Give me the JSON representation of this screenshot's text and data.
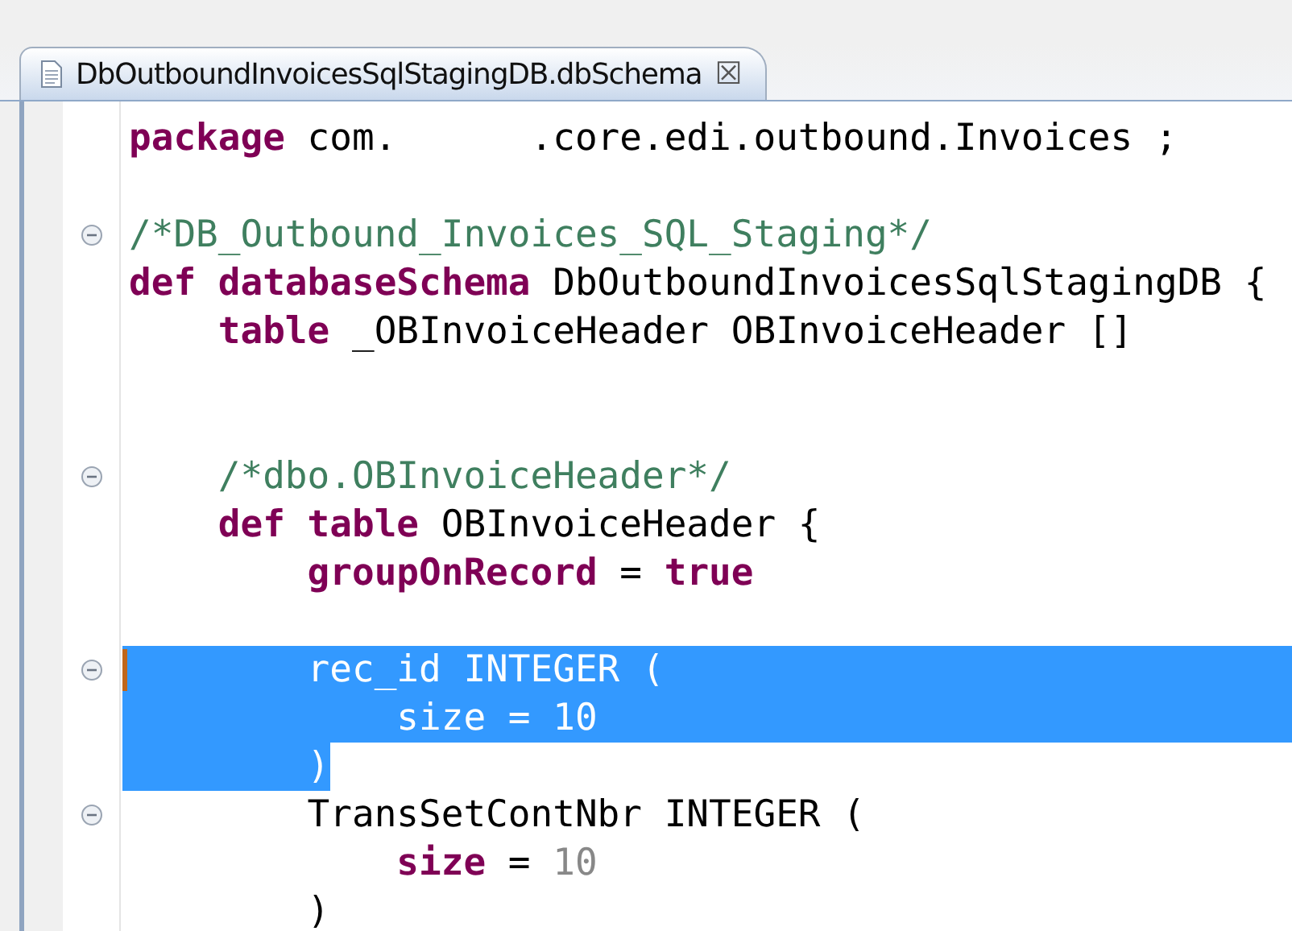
{
  "tab": {
    "title": "DbOutboundInvoicesSqlStagingDB.dbSchema",
    "close": "☒",
    "selected": true
  },
  "lines": [
    {
      "selected": false,
      "changed": false,
      "tokens": [
        {
          "kind": "keyword",
          "text": "package"
        },
        {
          "kind": "plain",
          "text": " com.      .core.edi.outbound.Invoices ;"
        }
      ]
    },
    {
      "selected": false,
      "changed": false
    },
    {
      "folded": false,
      "selected": false,
      "changed": false,
      "tokens": [
        {
          "kind": "comment",
          "text": "/*DB_Outbound_Invoices_SQL_Staging*/"
        }
      ]
    },
    {
      "selected": false,
      "changed": false,
      "tokens": [
        {
          "kind": "keyword",
          "text": "def databaseSchema"
        },
        {
          "kind": "plain",
          "text": " DbOutboundInvoicesSqlStagingDB {"
        }
      ]
    },
    {
      "selected": false,
      "changed": false,
      "tokens": [
        {
          "kind": "keyword",
          "text": "    table"
        },
        {
          "kind": "plain",
          "text": " _OBInvoiceHeader OBInvoiceHeader []"
        }
      ]
    },
    {
      "selected": false,
      "changed": false
    },
    {
      "selected": false,
      "changed": false
    },
    {
      "folded": false,
      "selected": false,
      "changed": false,
      "tokens": [
        {
          "kind": "comment",
          "text": "    /*dbo.OBInvoiceHeader*/"
        }
      ]
    },
    {
      "selected": false,
      "changed": false,
      "tokens": [
        {
          "kind": "keyword",
          "text": "    def table"
        },
        {
          "kind": "plain",
          "text": " OBInvoiceHeader {"
        }
      ]
    },
    {
      "selected": false,
      "changed": false,
      "tokens": [
        {
          "kind": "keyword",
          "text": "        groupOnRecord"
        },
        {
          "kind": "plain",
          "text": " = "
        },
        {
          "kind": "keyword",
          "text": "true"
        }
      ]
    },
    {
      "selected": false,
      "changed": false
    },
    {
      "folded": false,
      "selected": true,
      "changed": true,
      "tokens": [
        {
          "kind": "plain",
          "text": "        rec_id INTEGER ("
        }
      ]
    },
    {
      "selected": true,
      "changed": false,
      "tokens": [
        {
          "kind": "plain",
          "text": "            size = 10"
        }
      ]
    },
    {
      "selected": true,
      "selection_ends": true,
      "changed": false,
      "tokens": [
        {
          "kind": "plain",
          "text": "        )"
        }
      ]
    },
    {
      "folded": false,
      "selected": false,
      "changed": false,
      "tokens": [
        {
          "kind": "plain",
          "text": "        TransSetContNbr INTEGER ("
        }
      ]
    },
    {
      "selected": false,
      "changed": false,
      "tokens": [
        {
          "kind": "keyword",
          "text": "            size"
        },
        {
          "kind": "plain",
          "text": " = "
        },
        {
          "kind": "number",
          "text": "10"
        }
      ]
    },
    {
      "selected": false,
      "changed": false,
      "tokens": [
        {
          "kind": "plain",
          "text": "        )"
        }
      ]
    }
  ]
}
